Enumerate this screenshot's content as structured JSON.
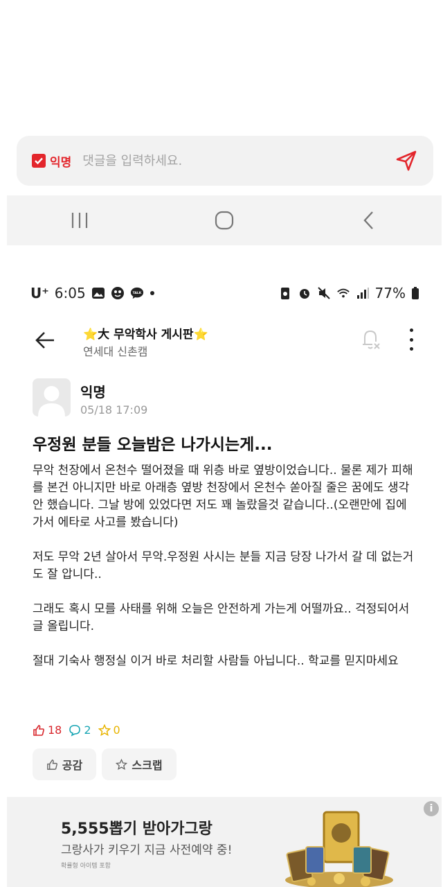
{
  "comment_bar": {
    "anon_label": "익명",
    "placeholder": "댓글을 입력하세요."
  },
  "status_bar": {
    "carrier": "U⁺",
    "time": "6:05",
    "battery": "77%"
  },
  "header": {
    "board_title": "⭐大 무악학사 게시판⭐",
    "board_subtitle": "연세대 신촌캠"
  },
  "post": {
    "author": "익명",
    "timestamp": "05/18 17:09",
    "title": "우정원 분들 오늘밤은 나가시는게...",
    "paragraphs": [
      "무악 천장에서 온천수 떨어졌을 때 위층 바로 옆방이었습니다.. 물론 제가 피해를 본건 아니지만 바로 아래층 옆방 천장에서 온천수 쏟아질 줄은 꿈에도 생각 안 했습니다. 그날 방에 있었다면 저도 꽤 놀랐을것 같습니다..(오랜만에 집에 가서 에타로 사고를 봤습니다)",
      "저도 무악 2년 살아서 무악.우정원 사시는 분들 지금 당장 나가서 갈 데 없는거도 잘 압니다..",
      "그래도 혹시 모를 사태를 위해 오늘은 안전하게 가는게 어떨까요.. 걱정되어서 글 올립니다.",
      "절대 기숙사 행정실 이거 바로 처리할 사람들 아닙니다.. 학교를 믿지마세요"
    ],
    "likes": "18",
    "comments": "2",
    "scraps": "0"
  },
  "actions": {
    "like_label": "공감",
    "scrap_label": "스크랩"
  },
  "ad": {
    "title": "5,555뽑기 받아가그랑",
    "subtitle": "그랑사가 키우기 지금 사전예약 중!",
    "note": "확률형 아이템 포함",
    "info": "i"
  },
  "colors": {
    "accent_red": "#e3262c",
    "comment_teal": "#1aa6b4",
    "scrap_yellow": "#e8b400"
  }
}
